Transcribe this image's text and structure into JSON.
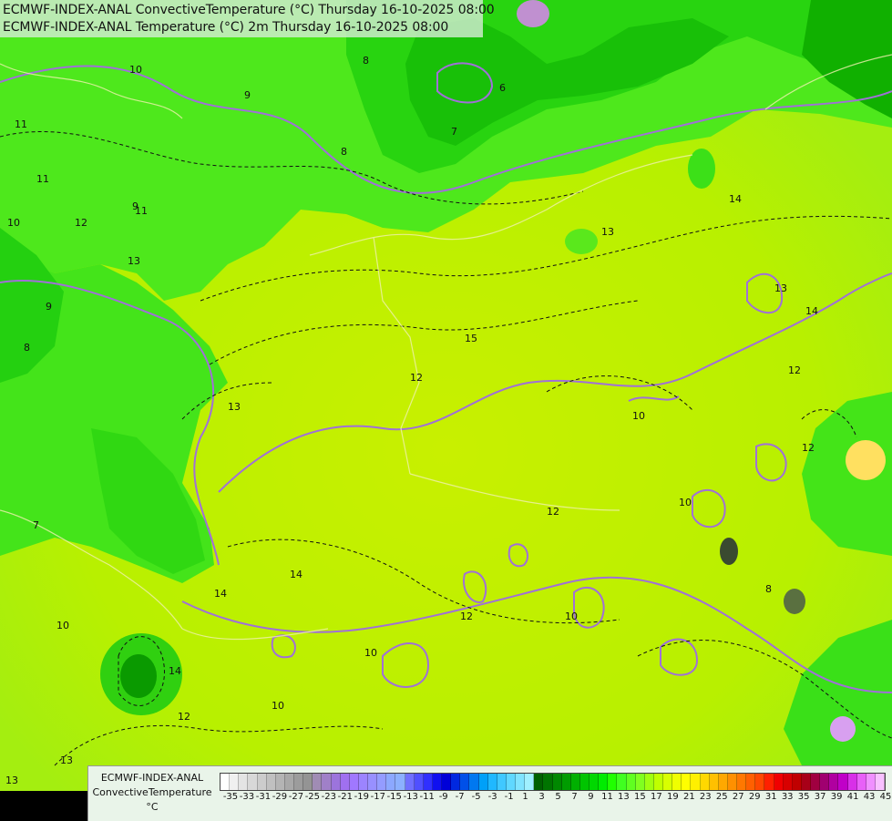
{
  "title": {
    "line1": "ECMWF-INDEX-ANAL ConvectiveTemperature (°C) Thursday 16-10-2025 08:00",
    "line2": "ECMWF-INDEX-ANAL Temperature (°C) 2m Thursday 16-10-2025 08:00"
  },
  "legend": {
    "line1": "ECMWF-INDEX-ANAL",
    "line2": "ConvectiveTemperature",
    "unit": "°C",
    "tick_labels": [
      "-35",
      "-33",
      "-31",
      "-29",
      "-27",
      "-25",
      "-23",
      "-21",
      "-19",
      "-17",
      "-15",
      "-13",
      "-11",
      "-9",
      "-7",
      "-5",
      "-3",
      "-1",
      "1",
      "3",
      "5",
      "7",
      "9",
      "11",
      "13",
      "15",
      "17",
      "19",
      "21",
      "23",
      "25",
      "27",
      "29",
      "31",
      "33",
      "35",
      "37",
      "39",
      "41",
      "43",
      "45"
    ],
    "colors": [
      "#ffffff",
      "#f0f0f0",
      "#e4e4e4",
      "#d8d8d8",
      "#cccccc",
      "#c0c0c0",
      "#b4b4b4",
      "#a8a8a8",
      "#9c9c9c",
      "#949494",
      "#a08cb4",
      "#a080c8",
      "#9c74dc",
      "#a070f0",
      "#a078ff",
      "#9c84ff",
      "#9890ff",
      "#949cff",
      "#8ca8ff",
      "#8cb0ff",
      "#7070ff",
      "#5050ff",
      "#3030ff",
      "#1010f0",
      "#0000d8",
      "#0028e0",
      "#0050e8",
      "#0078f0",
      "#00a0f8",
      "#20b8ff",
      "#40c8ff",
      "#60d8ff",
      "#80e4ff",
      "#a0f0ff",
      "#006000",
      "#007400",
      "#008800",
      "#009c00",
      "#00b000",
      "#00c400",
      "#00d800",
      "#00ec00",
      "#20ff00",
      "#40ff20",
      "#60ff20",
      "#80ff20",
      "#a0ff10",
      "#c0ff00",
      "#d8ff00",
      "#f0ff00",
      "#ffff00",
      "#fff000",
      "#ffd800",
      "#ffc000",
      "#ffa800",
      "#ff9000",
      "#ff7800",
      "#ff6000",
      "#ff4800",
      "#ff2000",
      "#f00000",
      "#d80000",
      "#c00000",
      "#a80018",
      "#a00040",
      "#a00070",
      "#b000a0",
      "#c000c8",
      "#d830e8",
      "#e860f8",
      "#f090ff",
      "#f8c0ff"
    ]
  },
  "map_labels": {
    "contours": [
      "10",
      "9",
      "8",
      "7",
      "6",
      "8",
      "11",
      "12",
      "11",
      "10",
      "13",
      "9",
      "8",
      "7",
      "13",
      "14",
      "15",
      "12",
      "13",
      "10",
      "14",
      "12",
      "10",
      "12",
      "14",
      "13",
      "10",
      "12",
      "14",
      "10",
      "11",
      "13",
      "12",
      "14",
      "13",
      "10",
      "9",
      "10",
      "12",
      "8"
    ]
  }
}
